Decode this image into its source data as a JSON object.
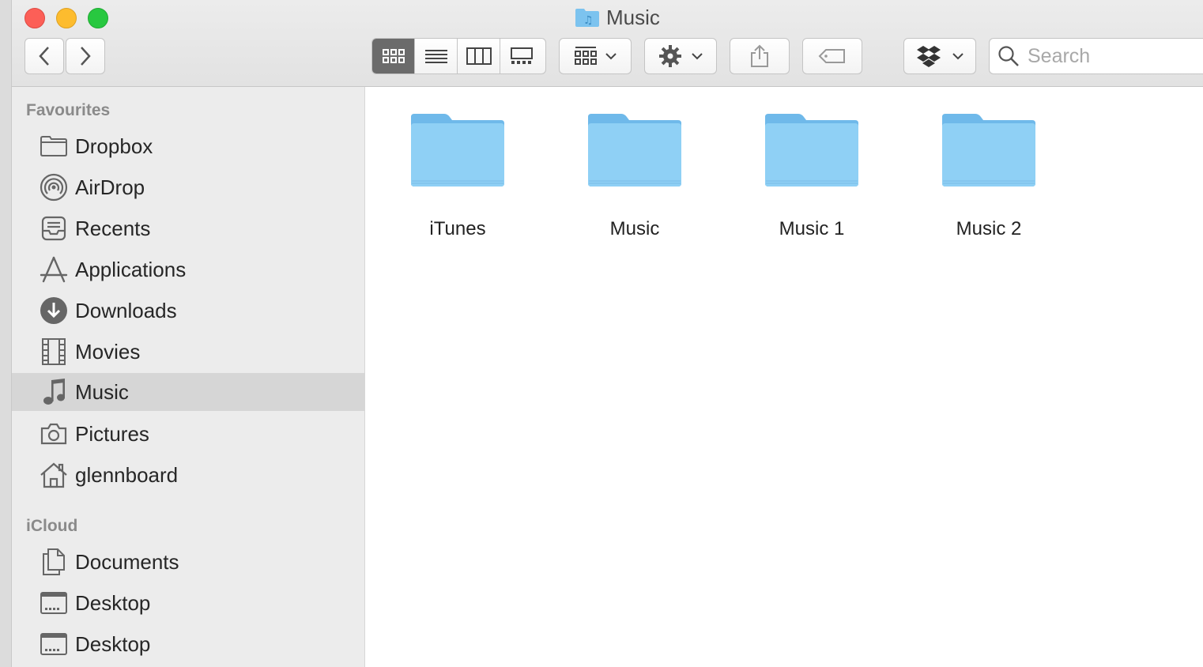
{
  "window": {
    "title": "Music"
  },
  "toolbar": {
    "search_placeholder": "Search",
    "view_modes": [
      "icon-view",
      "list-view",
      "column-view",
      "gallery-view"
    ],
    "active_view": "icon-view"
  },
  "sidebar": {
    "favourites_label": "Favourites",
    "favourites": [
      {
        "label": "Dropbox",
        "icon": "folder-icon"
      },
      {
        "label": "AirDrop",
        "icon": "airdrop-icon"
      },
      {
        "label": "Recents",
        "icon": "recents-icon"
      },
      {
        "label": "Applications",
        "icon": "applications-icon"
      },
      {
        "label": "Downloads",
        "icon": "downloads-icon"
      },
      {
        "label": "Movies",
        "icon": "film-icon"
      },
      {
        "label": "Music",
        "icon": "music-note-icon",
        "selected": true
      },
      {
        "label": "Pictures",
        "icon": "camera-icon"
      },
      {
        "label": "glennboard",
        "icon": "home-icon"
      }
    ],
    "icloud_label": "iCloud",
    "icloud": [
      {
        "label": "Documents",
        "icon": "documents-icon"
      },
      {
        "label": "Desktop",
        "icon": "desktop-icon"
      },
      {
        "label": "Desktop",
        "icon": "desktop-icon"
      }
    ]
  },
  "content": {
    "folders": [
      {
        "name": "iTunes"
      },
      {
        "name": "Music"
      },
      {
        "name": "Music 1"
      },
      {
        "name": "Music 2"
      }
    ]
  },
  "colors": {
    "folder": "#8dcdf3",
    "selection": "#d6d6d6",
    "sidebar": "#ececec"
  }
}
